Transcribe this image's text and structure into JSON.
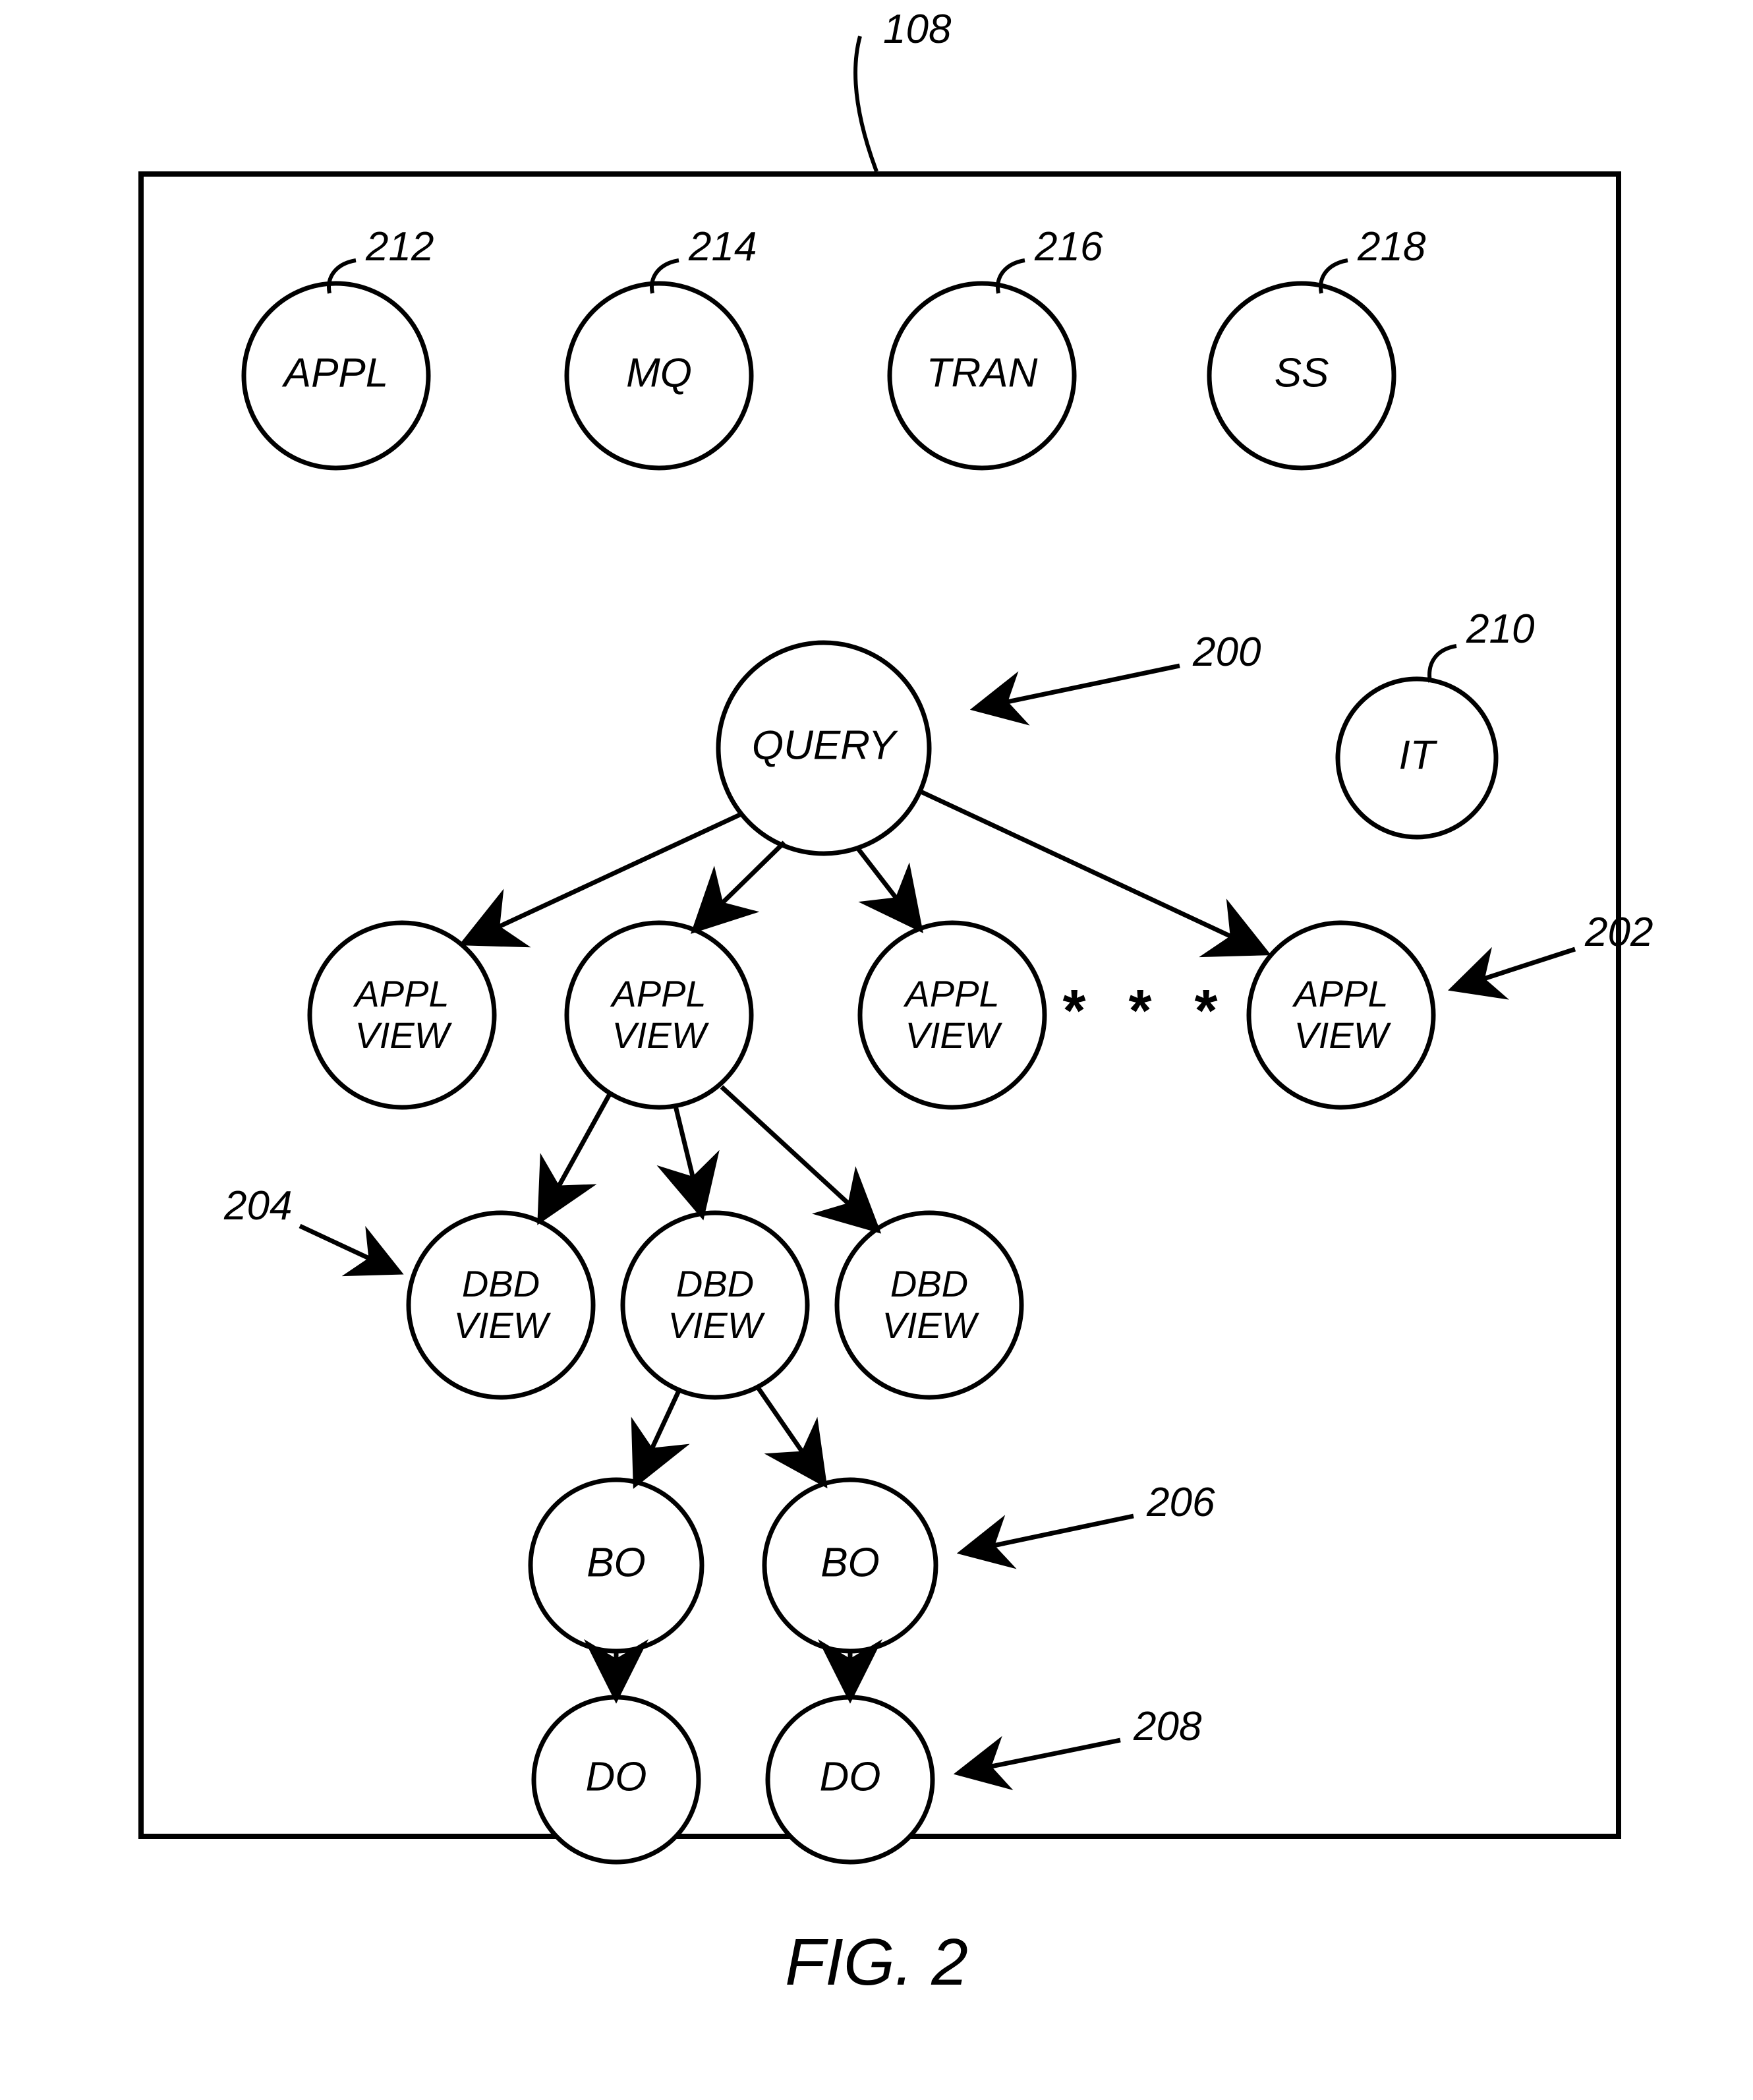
{
  "figure_caption": "FIG. 2",
  "container_ref": "108",
  "ellipsis": "* * *",
  "nodes": {
    "appl": "APPL",
    "mq": "MQ",
    "tran": "TRAN",
    "ss": "SS",
    "it": "IT",
    "query": "QUERY",
    "appl_view_1a": "APPL",
    "appl_view_1b": "VIEW",
    "appl_view_2a": "APPL",
    "appl_view_2b": "VIEW",
    "appl_view_3a": "APPL",
    "appl_view_3b": "VIEW",
    "appl_view_4a": "APPL",
    "appl_view_4b": "VIEW",
    "dbd_view_1a": "DBD",
    "dbd_view_1b": "VIEW",
    "dbd_view_2a": "DBD",
    "dbd_view_2b": "VIEW",
    "dbd_view_3a": "DBD",
    "dbd_view_3b": "VIEW",
    "bo_1": "BO",
    "bo_2": "BO",
    "do_1": "DO",
    "do_2": "DO"
  },
  "refs": {
    "r212": "212",
    "r214": "214",
    "r216": "216",
    "r218": "218",
    "r210": "210",
    "r200": "200",
    "r202": "202",
    "r204": "204",
    "r206": "206",
    "r208": "208"
  }
}
